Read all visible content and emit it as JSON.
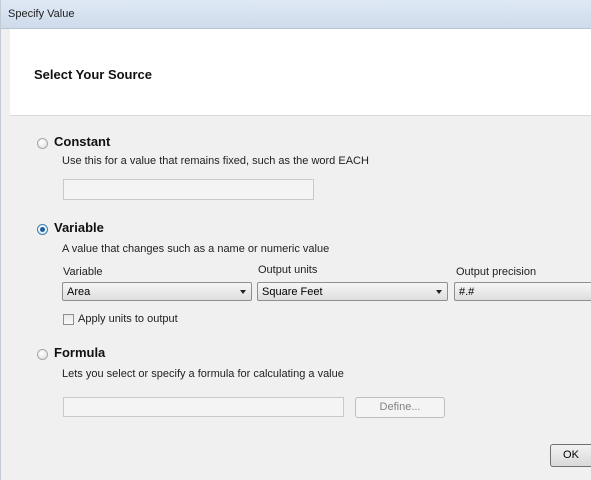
{
  "window": {
    "title": "Specify Value"
  },
  "header": {
    "title": "Select Your Source"
  },
  "options": {
    "constant": {
      "label": "Constant",
      "description": "Use this for a value that remains fixed, such as the word EACH",
      "value": ""
    },
    "variable": {
      "label": "Variable",
      "description": "A value that changes such as a name or numeric value",
      "variable_label": "Variable",
      "variable_value": "Area",
      "output_units_label": "Output units",
      "output_units_value": "Square Feet",
      "output_precision_label": "Output precision",
      "output_precision_value": "#.#",
      "apply_units_label": "Apply units to output"
    },
    "formula": {
      "label": "Formula",
      "description": "Lets you select or specify a formula for calculating a value",
      "value": "",
      "define_label": "Define..."
    }
  },
  "footer": {
    "ok_label": "OK"
  }
}
